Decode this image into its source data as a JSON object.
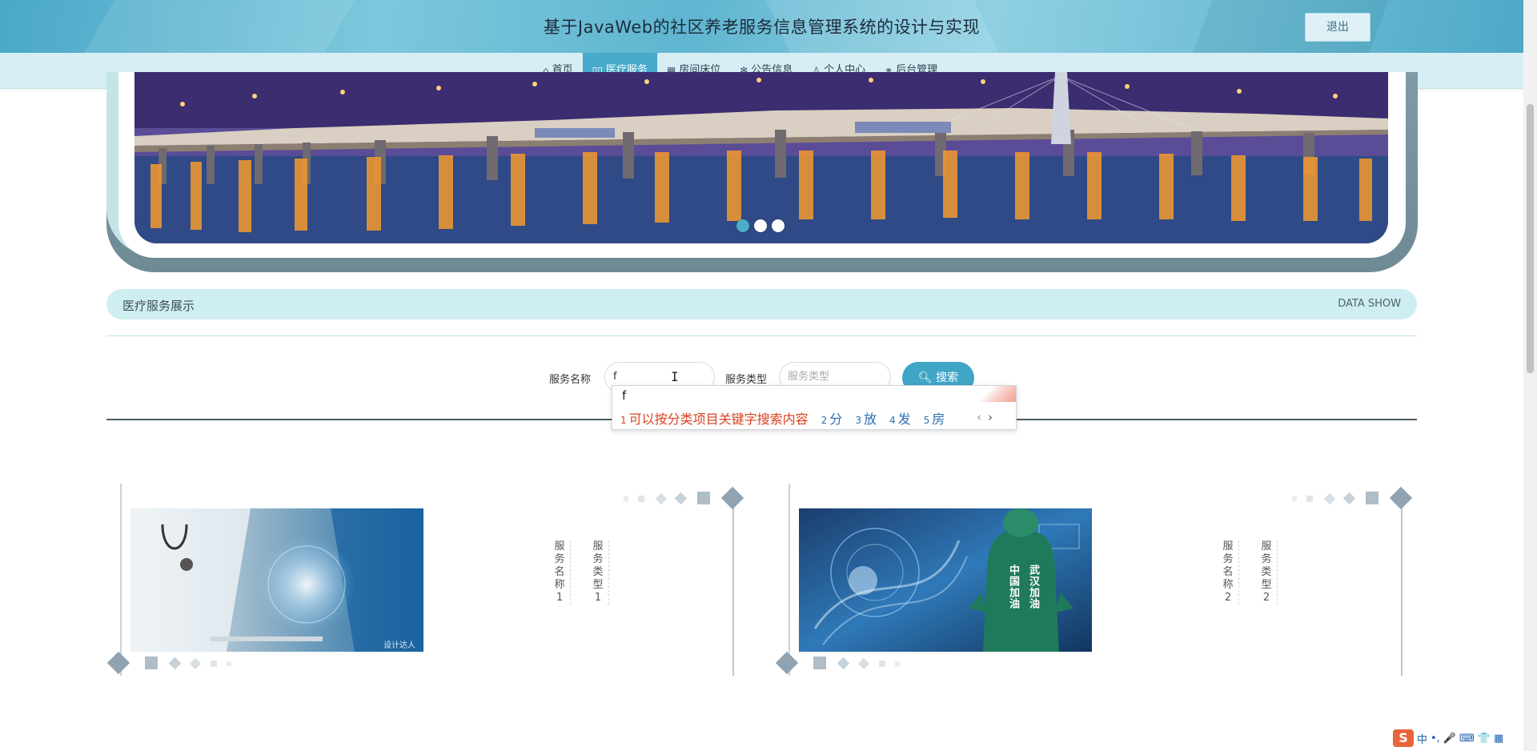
{
  "header": {
    "title": "基于JavaWeb的社区养老服务信息管理系统的设计与实现",
    "logout_label": "退出"
  },
  "nav": {
    "items": [
      {
        "label": "首页",
        "icon": "home-icon"
      },
      {
        "label": "医疗服务",
        "icon": "book-icon",
        "active": true
      },
      {
        "label": "房间床位",
        "icon": "calendar-icon"
      },
      {
        "label": "公告信息",
        "icon": "snowflake-icon"
      },
      {
        "label": "个人中心",
        "icon": "user-icon"
      },
      {
        "label": "后台管理",
        "icon": "link-icon"
      }
    ]
  },
  "banner": {
    "slides": 3,
    "active_slide": 1
  },
  "section": {
    "title": "医疗服务展示",
    "subtitle": "DATA SHOW"
  },
  "search": {
    "name_label": "服务名称",
    "name_value": "f",
    "type_label": "服务类型",
    "type_placeholder": "服务类型",
    "button_label": "搜索"
  },
  "ime": {
    "composition": "f",
    "candidates": [
      {
        "n": "1",
        "text": "可以按分类项目关键字搜索内容"
      },
      {
        "n": "2",
        "text": "分"
      },
      {
        "n": "3",
        "text": "放"
      },
      {
        "n": "4",
        "text": "发"
      },
      {
        "n": "5",
        "text": "房"
      }
    ],
    "prev": "‹",
    "next": "›"
  },
  "cards": [
    {
      "name": "服务名称1",
      "type": "服务类型1",
      "watermark": "设计达人"
    },
    {
      "name": "服务名称2",
      "type": "服务类型2",
      "overlay_left": "中国加油",
      "overlay_right": "武汉加油"
    }
  ],
  "tray": {
    "logo": "S",
    "items": [
      "中",
      "•,",
      "🎤",
      "⌨",
      "👕",
      "▦"
    ]
  },
  "colors": {
    "accent": "#47aacb",
    "nav_bg": "#d7eff4",
    "section_bg": "#cfeef2",
    "ime_first_candidate": "#d9401f",
    "ime_candidate": "#2b6fb0"
  }
}
